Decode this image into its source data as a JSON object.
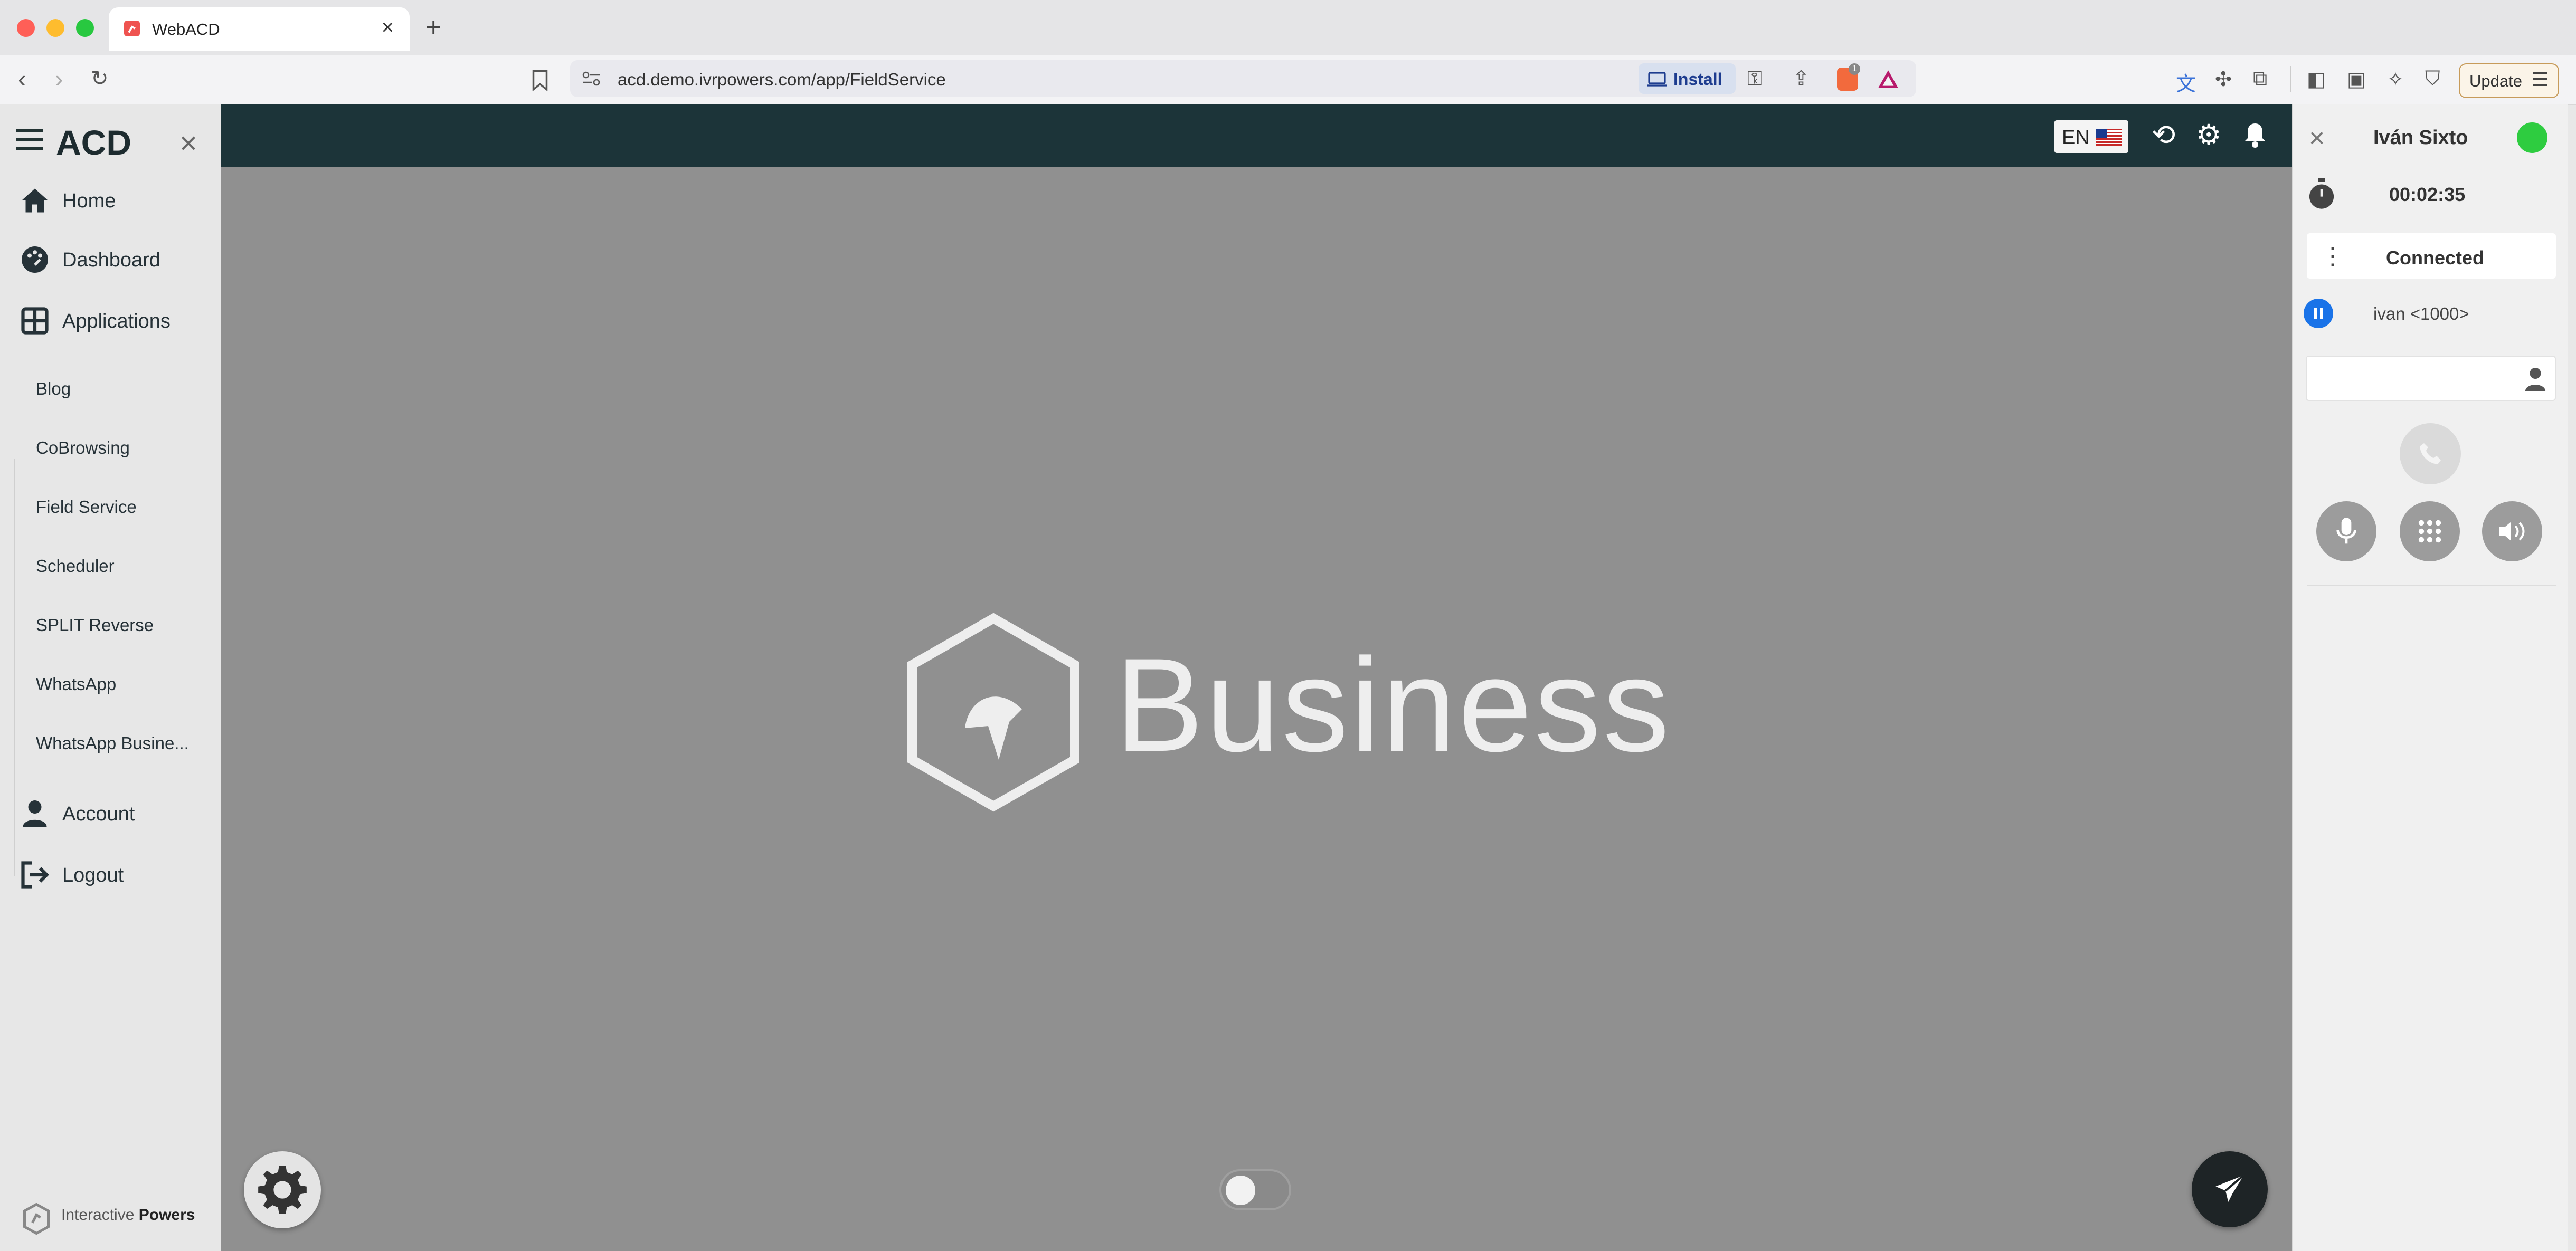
{
  "browser": {
    "tab_title": "WebACD",
    "url": "acd.demo.ivrpowers.com/app/FieldService",
    "install_label": "Install",
    "update_label": "Update",
    "extension_badge": "1"
  },
  "sidebar": {
    "brand": "ACD",
    "nav": [
      {
        "label": "Home",
        "icon": "home-icon"
      },
      {
        "label": "Dashboard",
        "icon": "dashboard-icon"
      },
      {
        "label": "Applications",
        "icon": "grid-icon"
      }
    ],
    "applications": [
      "Blog",
      "CoBrowsing",
      "Field Service",
      "Scheduler",
      "SPLIT Reverse",
      "WhatsApp",
      "WhatsApp Busine..."
    ],
    "bottom_nav": [
      {
        "label": "Account",
        "icon": "user-icon"
      },
      {
        "label": "Logout",
        "icon": "logout-icon"
      }
    ],
    "footer": {
      "text_light": "Interactive ",
      "text_bold": "Powers"
    }
  },
  "topbar": {
    "language": "EN"
  },
  "main": {
    "logo_word": "Business"
  },
  "phone_panel": {
    "agent_name": "Iván Sixto",
    "status_color": "#2ecc40",
    "timer": "00:02:35",
    "call_status": "Connected",
    "caller": "ivan <1000>",
    "dial_value": ""
  },
  "colors": {
    "topbar": "#1c3439",
    "main_bg": "#909090",
    "accent_blue": "#1a73e8"
  }
}
